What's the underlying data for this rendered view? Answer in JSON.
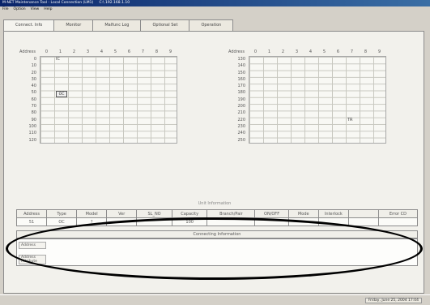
{
  "window": {
    "title": "M-NET Maintenance Tool - Local Connection (LM1)",
    "title_extra": "C:\\ 192.168.1.10"
  },
  "menu": [
    "File",
    "Option",
    "View",
    "Help"
  ],
  "tabs": [
    "Connect. Info",
    "Monitor",
    "Malfunc Log",
    "Optional Set",
    "Operation"
  ],
  "grid_left": {
    "address_header": "Address",
    "columns": [
      "0",
      "1",
      "2",
      "3",
      "4",
      "5",
      "6",
      "7",
      "8",
      "9"
    ],
    "rows": [
      "0",
      "10",
      "20",
      "30",
      "40",
      "50",
      "60",
      "70",
      "80",
      "90",
      "100",
      "110",
      "120"
    ],
    "markers": [
      {
        "row": 0,
        "col": 1,
        "text": "IC",
        "boxed": false
      },
      {
        "row": 5,
        "col": 1,
        "text": "OC",
        "boxed": true
      }
    ]
  },
  "grid_right": {
    "address_header": "Address",
    "columns": [
      "0",
      "1",
      "2",
      "3",
      "4",
      "5",
      "6",
      "7",
      "8",
      "9"
    ],
    "rows": [
      "130",
      "140",
      "150",
      "160",
      "170",
      "180",
      "190",
      "200",
      "210",
      "220",
      "230",
      "240",
      "250"
    ],
    "markers": [
      {
        "row": 9,
        "col": 7,
        "text": "TR",
        "boxed": false
      }
    ]
  },
  "unit_info": {
    "title": "Unit Information",
    "headers": [
      "Address",
      "Type",
      "Model",
      "Ver",
      "SL_NO",
      "Capacity",
      "Branch/Pair",
      "ON/OFF",
      "Mode",
      "Interlock",
      "",
      "Error CD"
    ],
    "values": [
      "51",
      "OC",
      "?",
      "",
      "",
      "100",
      "",
      "",
      "",
      "",
      "",
      ""
    ]
  },
  "connecting": {
    "title": "Connecting Information",
    "labels": [
      "Address",
      "Address Attribute"
    ]
  },
  "status": {
    "date": "Friday, June 25, 2004 17:04"
  }
}
